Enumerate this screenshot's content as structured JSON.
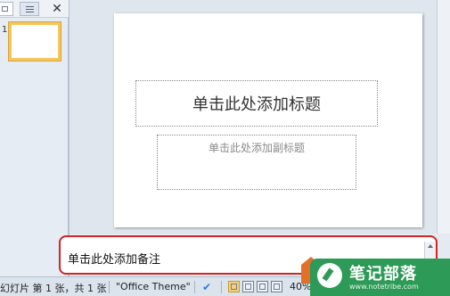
{
  "left_pane": {
    "close_glyph": "✕",
    "thumbnail_number": "1"
  },
  "slide": {
    "title_placeholder": "单击此处添加标题",
    "subtitle_placeholder": "单击此处添加副标题"
  },
  "notes": {
    "placeholder": "单击此处添加备注"
  },
  "status_bar": {
    "slide_info": "幻灯片 第 1 张，共 1 张",
    "theme": "\"Office Theme\"",
    "check_glyph": "✔",
    "zoom": "40%"
  },
  "watermark": {
    "title": "笔记部落",
    "url": "www.notetribe.com"
  },
  "colors": {
    "highlight_border": "#d42424",
    "thumbnail_selected": "#f4c65c",
    "watermark_green": "#2e9a57"
  }
}
